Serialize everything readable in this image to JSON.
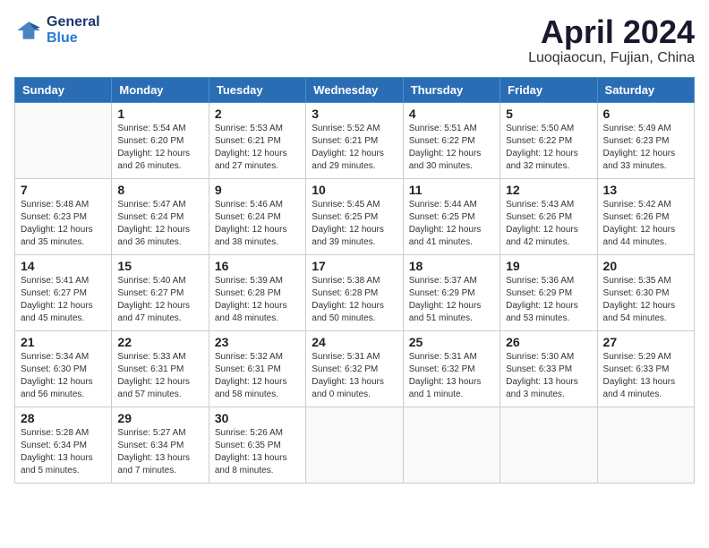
{
  "logo": {
    "line1": "General",
    "line2": "Blue"
  },
  "title": "April 2024",
  "location": "Luoqiaocun, Fujian, China",
  "days_of_week": [
    "Sunday",
    "Monday",
    "Tuesday",
    "Wednesday",
    "Thursday",
    "Friday",
    "Saturday"
  ],
  "weeks": [
    [
      {
        "day": "",
        "info": ""
      },
      {
        "day": "1",
        "info": "Sunrise: 5:54 AM\nSunset: 6:20 PM\nDaylight: 12 hours\nand 26 minutes."
      },
      {
        "day": "2",
        "info": "Sunrise: 5:53 AM\nSunset: 6:21 PM\nDaylight: 12 hours\nand 27 minutes."
      },
      {
        "day": "3",
        "info": "Sunrise: 5:52 AM\nSunset: 6:21 PM\nDaylight: 12 hours\nand 29 minutes."
      },
      {
        "day": "4",
        "info": "Sunrise: 5:51 AM\nSunset: 6:22 PM\nDaylight: 12 hours\nand 30 minutes."
      },
      {
        "day": "5",
        "info": "Sunrise: 5:50 AM\nSunset: 6:22 PM\nDaylight: 12 hours\nand 32 minutes."
      },
      {
        "day": "6",
        "info": "Sunrise: 5:49 AM\nSunset: 6:23 PM\nDaylight: 12 hours\nand 33 minutes."
      }
    ],
    [
      {
        "day": "7",
        "info": "Sunrise: 5:48 AM\nSunset: 6:23 PM\nDaylight: 12 hours\nand 35 minutes."
      },
      {
        "day": "8",
        "info": "Sunrise: 5:47 AM\nSunset: 6:24 PM\nDaylight: 12 hours\nand 36 minutes."
      },
      {
        "day": "9",
        "info": "Sunrise: 5:46 AM\nSunset: 6:24 PM\nDaylight: 12 hours\nand 38 minutes."
      },
      {
        "day": "10",
        "info": "Sunrise: 5:45 AM\nSunset: 6:25 PM\nDaylight: 12 hours\nand 39 minutes."
      },
      {
        "day": "11",
        "info": "Sunrise: 5:44 AM\nSunset: 6:25 PM\nDaylight: 12 hours\nand 41 minutes."
      },
      {
        "day": "12",
        "info": "Sunrise: 5:43 AM\nSunset: 6:26 PM\nDaylight: 12 hours\nand 42 minutes."
      },
      {
        "day": "13",
        "info": "Sunrise: 5:42 AM\nSunset: 6:26 PM\nDaylight: 12 hours\nand 44 minutes."
      }
    ],
    [
      {
        "day": "14",
        "info": "Sunrise: 5:41 AM\nSunset: 6:27 PM\nDaylight: 12 hours\nand 45 minutes."
      },
      {
        "day": "15",
        "info": "Sunrise: 5:40 AM\nSunset: 6:27 PM\nDaylight: 12 hours\nand 47 minutes."
      },
      {
        "day": "16",
        "info": "Sunrise: 5:39 AM\nSunset: 6:28 PM\nDaylight: 12 hours\nand 48 minutes."
      },
      {
        "day": "17",
        "info": "Sunrise: 5:38 AM\nSunset: 6:28 PM\nDaylight: 12 hours\nand 50 minutes."
      },
      {
        "day": "18",
        "info": "Sunrise: 5:37 AM\nSunset: 6:29 PM\nDaylight: 12 hours\nand 51 minutes."
      },
      {
        "day": "19",
        "info": "Sunrise: 5:36 AM\nSunset: 6:29 PM\nDaylight: 12 hours\nand 53 minutes."
      },
      {
        "day": "20",
        "info": "Sunrise: 5:35 AM\nSunset: 6:30 PM\nDaylight: 12 hours\nand 54 minutes."
      }
    ],
    [
      {
        "day": "21",
        "info": "Sunrise: 5:34 AM\nSunset: 6:30 PM\nDaylight: 12 hours\nand 56 minutes."
      },
      {
        "day": "22",
        "info": "Sunrise: 5:33 AM\nSunset: 6:31 PM\nDaylight: 12 hours\nand 57 minutes."
      },
      {
        "day": "23",
        "info": "Sunrise: 5:32 AM\nSunset: 6:31 PM\nDaylight: 12 hours\nand 58 minutes."
      },
      {
        "day": "24",
        "info": "Sunrise: 5:31 AM\nSunset: 6:32 PM\nDaylight: 13 hours\nand 0 minutes."
      },
      {
        "day": "25",
        "info": "Sunrise: 5:31 AM\nSunset: 6:32 PM\nDaylight: 13 hours\nand 1 minute."
      },
      {
        "day": "26",
        "info": "Sunrise: 5:30 AM\nSunset: 6:33 PM\nDaylight: 13 hours\nand 3 minutes."
      },
      {
        "day": "27",
        "info": "Sunrise: 5:29 AM\nSunset: 6:33 PM\nDaylight: 13 hours\nand 4 minutes."
      }
    ],
    [
      {
        "day": "28",
        "info": "Sunrise: 5:28 AM\nSunset: 6:34 PM\nDaylight: 13 hours\nand 5 minutes."
      },
      {
        "day": "29",
        "info": "Sunrise: 5:27 AM\nSunset: 6:34 PM\nDaylight: 13 hours\nand 7 minutes."
      },
      {
        "day": "30",
        "info": "Sunrise: 5:26 AM\nSunset: 6:35 PM\nDaylight: 13 hours\nand 8 minutes."
      },
      {
        "day": "",
        "info": ""
      },
      {
        "day": "",
        "info": ""
      },
      {
        "day": "",
        "info": ""
      },
      {
        "day": "",
        "info": ""
      }
    ]
  ]
}
